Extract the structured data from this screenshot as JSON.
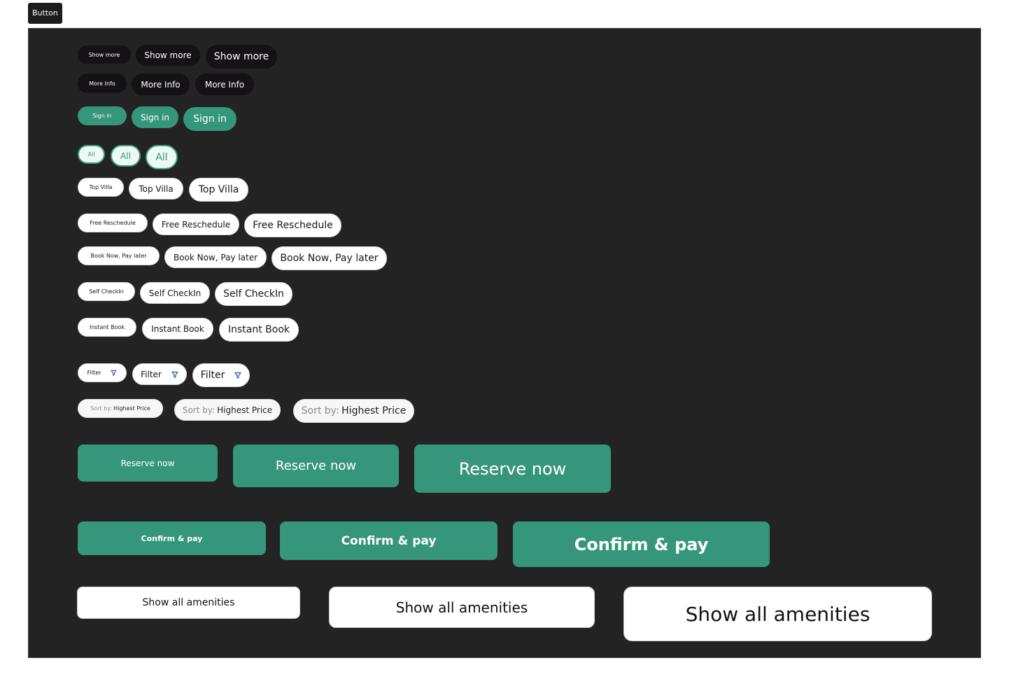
{
  "frame_label": "Button",
  "buttons": {
    "show_more": "Show more",
    "more_info": "More Info",
    "sign_in": "Sign in",
    "all": "All",
    "top_villa": "Top Villa",
    "free_reschedule": "Free Reschedule",
    "book_now_pay_later": "Book Now, Pay later",
    "self_checkin": "Self CheckIn",
    "instant_book": "Instant Book",
    "filter": "Filter",
    "sort_prefix": "Sort by:",
    "sort_value": "Highest Price",
    "reserve_now": "Reserve now",
    "confirm_pay": "Confirm & pay",
    "show_all_amenities": "Show all amenities"
  },
  "icons": {
    "filter": "filter-funnel-icon"
  },
  "colors": {
    "canvas_bg": "#232323",
    "dark_button": "#141214",
    "primary_green": "#36967b",
    "outline_green_fill": "#eef8f4",
    "chip_white": "#ffffff"
  }
}
